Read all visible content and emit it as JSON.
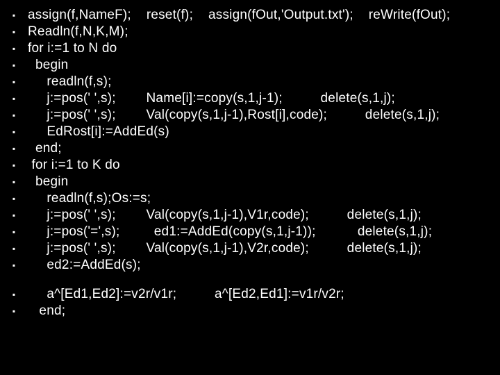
{
  "bullet": "▪",
  "lines": [
    "assign(f,NameF);    reset(f);    assign(fOut,'Output.txt');    reWrite(fOut);",
    "Readln(f,N,K,M);",
    "for i:=1 to N do",
    "  begin",
    "     readln(f,s);",
    "     j:=pos(' ',s);        Name[i]:=copy(s,1,j-1);          delete(s,1,j);",
    "     j:=pos(' ',s);        Val(copy(s,1,j-1),Rost[i],code);          delete(s,1,j);",
    "     EdRost[i]:=AddEd(s)",
    "  end;",
    " for i:=1 to K do",
    "  begin",
    "     readln(f,s);Os:=s;",
    "     j:=pos(' ',s);        Val(copy(s,1,j-1),V1r,code);          delete(s,1,j);",
    "     j:=pos('=',s);         ed1:=AddEd(copy(s,1,j-1));           delete(s,1,j);",
    "     j:=pos(' ',s);        Val(copy(s,1,j-1),V2r,code);          delete(s,1,j);",
    "     ed2:=AddEd(s);"
  ],
  "lines2": [
    "     a^[Ed1,Ed2]:=v2r/v1r;          a^[Ed2,Ed1]:=v1r/v2r;",
    "   end;"
  ]
}
